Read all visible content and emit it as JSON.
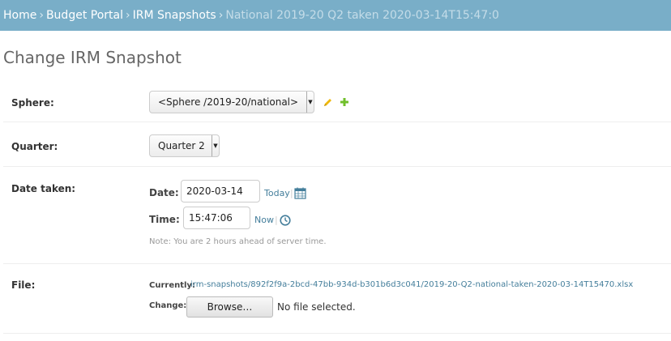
{
  "breadcrumbs": {
    "home": "Home",
    "portal": "Budget Portal",
    "section": "IRM Snapshots",
    "current": "National 2019-20 Q2 taken 2020-03-14T15:47:0",
    "separator": "›"
  },
  "page_title": "Change IRM Snapshot",
  "sphere": {
    "label": "Sphere:",
    "selected": "<Sphere /2019-20/national>"
  },
  "quarter": {
    "label": "Quarter:",
    "selected": "Quarter 2"
  },
  "date_taken": {
    "label": "Date taken:",
    "date_label": "Date:",
    "date_value": "2020-03-14",
    "today_link": "Today",
    "time_label": "Time:",
    "time_value": "15:47:06",
    "now_link": "Now",
    "separator": "|",
    "note": "Note: You are 2 hours ahead of server time."
  },
  "file": {
    "label": "File:",
    "currently_label": "Currently:",
    "currently_link": "irm-snapshots/892f2f9a-2bcd-47bb-934d-b301b6d3c041/2019-20-Q2-national-taken-2020-03-14T15470.xlsx",
    "change_label": "Change:",
    "browse_label": "Browse…",
    "no_file": "No file selected."
  },
  "colors": {
    "header_bg": "#79aec8",
    "link": "#447e9b",
    "edit_icon": "#efb80b",
    "add_icon": "#70bf2b"
  },
  "icons": {
    "edit": "pencil-icon",
    "add": "plus-icon",
    "calendar": "calendar-icon",
    "clock": "clock-icon"
  }
}
